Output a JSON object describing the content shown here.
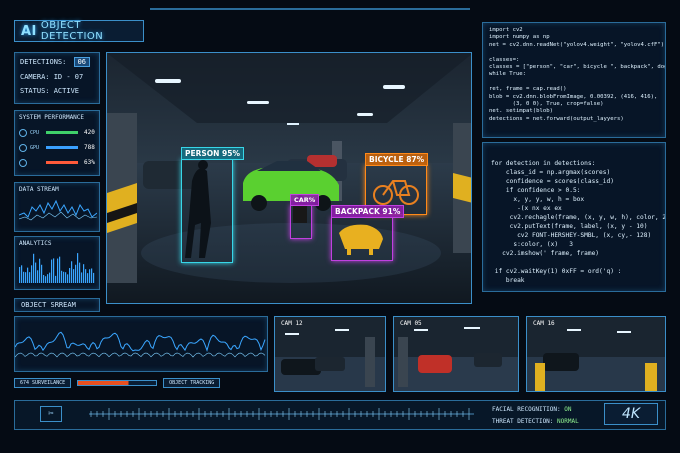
{
  "header": {
    "ai": "AI",
    "title": "OBJECT DETECTION"
  },
  "info": {
    "detections_label": "DETECTIONS:",
    "detections_count": "06",
    "camera": "CAMERA: ID - 07",
    "status": "STATUS: ACTIVE"
  },
  "performance": {
    "title": "SYSTEM PERFORMANCE",
    "rows": [
      {
        "label": "CPU",
        "value": "420",
        "color": "#3fd06a"
      },
      {
        "label": "GPU",
        "value": "788",
        "color": "#3aa0ff"
      },
      {
        "label": "",
        "value": "63%",
        "color": "#ff5a3a"
      }
    ]
  },
  "data_stream": {
    "title": "DATA STREAM"
  },
  "analytics": {
    "title": "ANALYTICS"
  },
  "object_stream": {
    "title": "OBJECT SRREAM"
  },
  "detections": [
    {
      "tag": "PERSON 95%",
      "color": "#38d6e8"
    },
    {
      "tag": "BICYCLE 87%",
      "color": "#ff8a1a"
    },
    {
      "tag": "CAR%",
      "color": "#c040e0"
    },
    {
      "tag": "BACKPACK 91%",
      "color": "#c040e0"
    }
  ],
  "code_top": [
    "import cv2",
    "import numpy as np",
    "net = cv2.dnn.readNet(\"yolov4.weight\", \"yolov4.cfF\")",
    "",
    "classes=:",
    "classes = [\"person\", \"car\", bicycle \", backpack\", dog]\"",
    "while True:",
    "",
    "ret, frame = cap.read()",
    "blob = cv2.dnn.blobFromImage, 0.00392, (416, 416),",
    "       (3, 0 0), True, crop=false)",
    "net. setimpat(blob)",
    "detections = net.forward(output_layyers)"
  ],
  "code_bottom": [
    "for detection in detections:",
    "    class_id = np.argmax(scores)",
    "    confidence = scores(class_id)",
    "    if confidence > 0.5:",
    "      x, y, y, w, h = box",
    "       -(x nx ex ex",
    "     cv2.rechagle(frame, (x, y, w, h), color, 2)",
    "     cv2.putText(frame, label, (x, y - 10)",
    "       cv2 FONT-HERSHEY-SMBL, (x, cy,- 128)",
    "      s:color, (x)   3",
    "   cv2.imshow(' frame, frame)",
    "",
    " if cv2.waitKey(1) 0xFF = ord('q) :",
    "    break"
  ],
  "cams": [
    {
      "label": "CAM 12"
    },
    {
      "label": "CAM 05"
    },
    {
      "label": "CAM 16"
    }
  ],
  "bottom_strip": {
    "chip1": "674  SURVEILANCE",
    "chip2": "OBJECT TRACKING"
  },
  "footer": {
    "facial_label": "FACIAL RECOGNITION:",
    "facial_value": "ON",
    "threat_label": "THREAT DETECTION:",
    "threat_value": "NORMAL",
    "logo": "4K"
  }
}
